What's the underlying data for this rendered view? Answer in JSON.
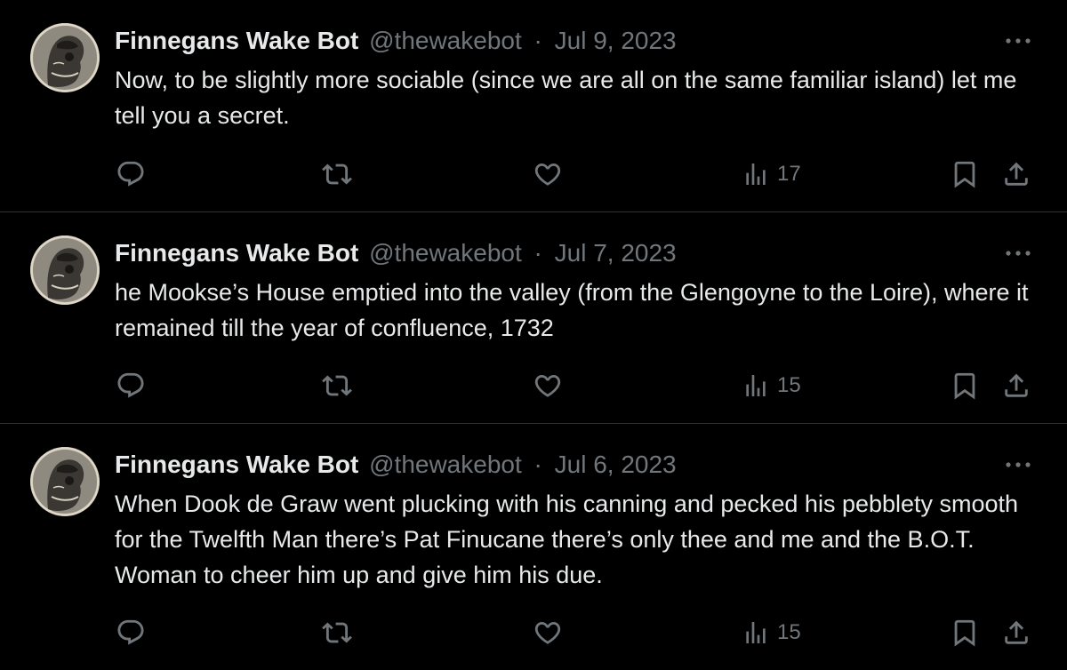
{
  "tweets": [
    {
      "name": "Finnegans Wake Bot",
      "handle": "@thewakebot",
      "separator": "·",
      "date": "Jul 9, 2023",
      "text": "Now, to be slightly more sociable (since we are all on the same familiar island) let me tell you a secret.",
      "views": "17"
    },
    {
      "name": "Finnegans Wake Bot",
      "handle": "@thewakebot",
      "separator": "·",
      "date": "Jul 7, 2023",
      "text": "he Mookse’s House emptied into the valley (from the Glengoyne to the Loire), where it remained till the year of confluence, 1732",
      "views": "15"
    },
    {
      "name": "Finnegans Wake Bot",
      "handle": "@thewakebot",
      "separator": "·",
      "date": "Jul 6, 2023",
      "text": "When Dook de Graw went plucking with his canning and pecked his pebblety smooth for the Twelfth Man there’s Pat Finucane there’s only thee and me and the B.O.T. Woman to cheer him up and give him his due.",
      "views": "15"
    }
  ],
  "icons": {
    "reply": "reply-icon",
    "retweet": "retweet-icon",
    "like": "heart-icon",
    "views": "views-icon",
    "bookmark": "bookmark-icon",
    "share": "share-icon",
    "more": "more-icon"
  },
  "colors": {
    "background": "#000000",
    "text_primary": "#e7e9ea",
    "text_secondary": "#71767b",
    "divider": "#2f3336"
  }
}
